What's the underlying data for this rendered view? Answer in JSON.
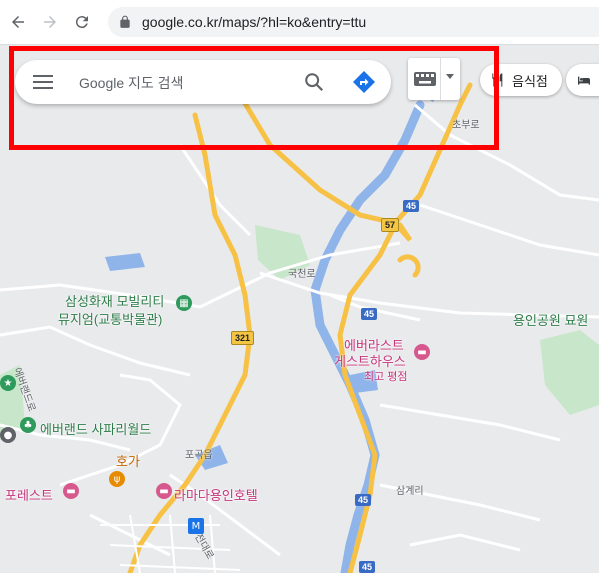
{
  "browser": {
    "url": "google.co.kr/maps/?hl=ko&entry=ttu"
  },
  "search": {
    "placeholder": "Google 지도 검색"
  },
  "chips": [
    {
      "label": "음식점"
    }
  ],
  "map": {
    "places": {
      "samsung_museum": "삼성화재 모빌리티",
      "samsung_museum_2": "뮤지엄(교통박물관)",
      "yongin_park": "용인공원 묘원",
      "everland_safari": "에버랜드 사파리월드",
      "everland_house": "에버라스트",
      "everland_house_2": "게스트하우스",
      "everland_house_sub": "최고 평점",
      "forest": "포레스트",
      "hoga": "호가",
      "lamada": "라마다용인호텔"
    },
    "roads": {
      "chobu": "초부로",
      "gukchi": "국천로",
      "pokok": "포곡읍",
      "samgye": "삼계리",
      "everland_ro": "에버랜드로",
      "jeondae": "전대로"
    },
    "shields": [
      "45",
      "57",
      "45",
      "321",
      "45",
      "45"
    ]
  },
  "colors": {
    "highlight": "#ff0000",
    "road_major": "#f6c144",
    "river": "#8fb4ea"
  }
}
